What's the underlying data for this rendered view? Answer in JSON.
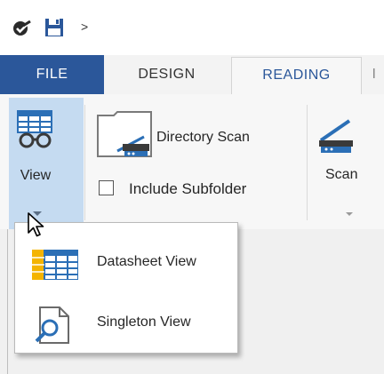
{
  "quick_access": {
    "check_icon": "checkmark-circle-icon",
    "save_icon": "floppy-save-icon",
    "more_label": ">"
  },
  "tabs": {
    "file": "FILE",
    "design": "DESIGN",
    "reading": "READING"
  },
  "ribbon": {
    "view_label": "View",
    "directory_scan_label": "Directory Scan",
    "include_subfolder_label": "Include Subfolder",
    "include_subfolder_checked": false,
    "scan_label": "Scan"
  },
  "menu": {
    "items": [
      {
        "label": "Datasheet View",
        "icon": "datasheet-grid-icon"
      },
      {
        "label": "Singleton View",
        "icon": "document-magnifier-icon"
      }
    ]
  },
  "colors": {
    "file_tab": "#2b579a",
    "active_tab_text": "#2b579a",
    "view_button_highlight": "#c5dbf1"
  }
}
